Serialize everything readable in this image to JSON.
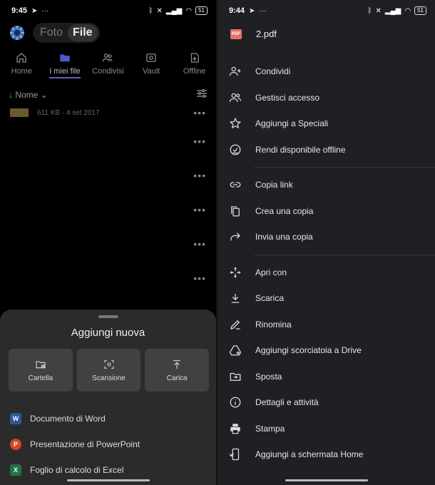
{
  "left": {
    "status": {
      "time": "9:45",
      "battery": "51"
    },
    "segment": {
      "photos": "Foto",
      "files": "File"
    },
    "tabs": [
      {
        "label": "Home",
        "icon": "home-icon"
      },
      {
        "label": "I miei file",
        "icon": "folder-icon"
      },
      {
        "label": "Condivisi",
        "icon": "people-icon"
      },
      {
        "label": "Vault",
        "icon": "vault-icon"
      },
      {
        "label": "Offline",
        "icon": "offline-icon"
      }
    ],
    "sort": {
      "label": "Nome"
    },
    "files": [
      {
        "meta": "611 KB · 4 set 2017"
      }
    ],
    "sheet": {
      "title": "Aggiungi nuova",
      "actions": [
        {
          "label": "Cartella",
          "icon": "new-folder-icon"
        },
        {
          "label": "Scansione",
          "icon": "scan-icon"
        },
        {
          "label": "Carica",
          "icon": "upload-icon"
        }
      ],
      "docs": [
        {
          "label": "Documento di Word",
          "badge": "W",
          "color": "#2b579a"
        },
        {
          "label": "Presentazione di PowerPoint",
          "badge": "P",
          "color": "#d24726"
        },
        {
          "label": "Foglio di calcolo di Excel",
          "badge": "X",
          "color": "#217346"
        }
      ]
    }
  },
  "right": {
    "status": {
      "time": "9:44",
      "battery": "51"
    },
    "file": {
      "name": "2.pdf",
      "type": "PDF"
    },
    "groups": [
      [
        {
          "label": "Condividi",
          "icon": "person-add-icon"
        },
        {
          "label": "Gestisci accesso",
          "icon": "manage-access-icon"
        },
        {
          "label": "Aggiungi a Speciali",
          "icon": "star-icon"
        },
        {
          "label": "Rendi disponibile offline",
          "icon": "offline-check-icon"
        }
      ],
      [
        {
          "label": "Copia link",
          "icon": "link-icon"
        },
        {
          "label": "Crea una copia",
          "icon": "copy-icon"
        },
        {
          "label": "Invia una copia",
          "icon": "send-icon"
        }
      ],
      [
        {
          "label": "Apri con",
          "icon": "open-with-icon"
        },
        {
          "label": "Scarica",
          "icon": "download-icon"
        },
        {
          "label": "Rinomina",
          "icon": "rename-icon"
        },
        {
          "label": "Aggiungi scorciatoia a Drive",
          "icon": "shortcut-icon"
        },
        {
          "label": "Sposta",
          "icon": "move-icon"
        },
        {
          "label": "Dettagli e attività",
          "icon": "info-icon"
        },
        {
          "label": "Stampa",
          "icon": "print-icon"
        },
        {
          "label": "Aggiungi a schermata Home",
          "icon": "add-home-icon"
        }
      ]
    ]
  }
}
